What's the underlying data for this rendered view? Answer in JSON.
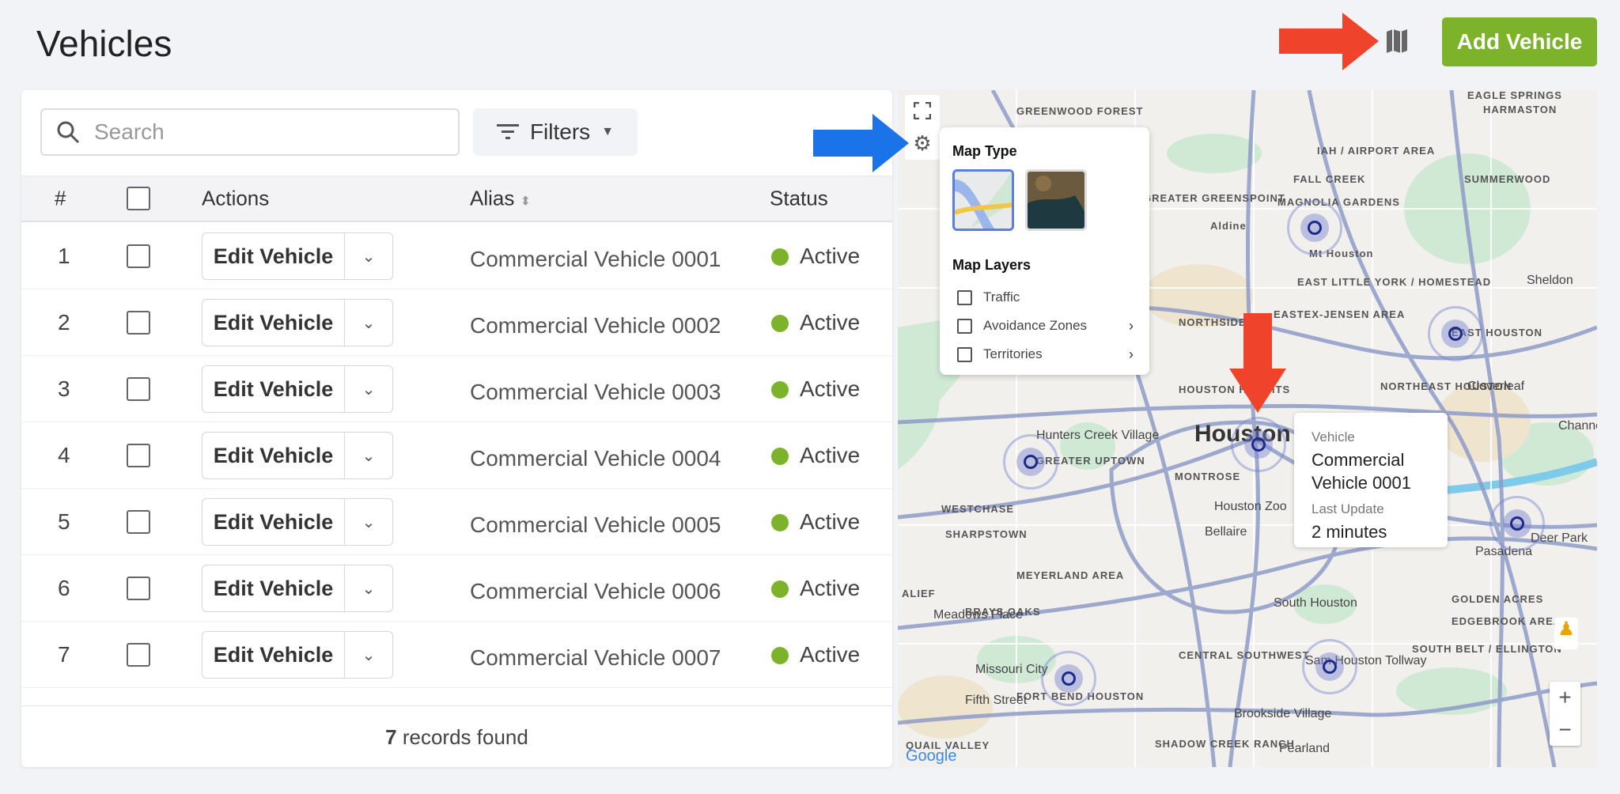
{
  "page": {
    "title": "Vehicles"
  },
  "header": {
    "add_button": "Add Vehicle",
    "map_toggle_icon": "map-icon"
  },
  "toolbar": {
    "search_placeholder": "Search",
    "search_value": "",
    "filters_label": "Filters"
  },
  "table": {
    "columns": [
      "#",
      "",
      "Actions",
      "Alias",
      "Status"
    ],
    "edit_label": "Edit Vehicle",
    "rows": [
      {
        "n": "1",
        "alias": "Commercial Vehicle 0001",
        "status": "Active"
      },
      {
        "n": "2",
        "alias": "Commercial Vehicle 0002",
        "status": "Active"
      },
      {
        "n": "3",
        "alias": "Commercial Vehicle 0003",
        "status": "Active"
      },
      {
        "n": "4",
        "alias": "Commercial Vehicle 0004",
        "status": "Active"
      },
      {
        "n": "5",
        "alias": "Commercial Vehicle 0005",
        "status": "Active"
      },
      {
        "n": "6",
        "alias": "Commercial Vehicle 0006",
        "status": "Active"
      },
      {
        "n": "7",
        "alias": "Commercial Vehicle 0007",
        "status": "Active"
      }
    ],
    "footer_count": "7",
    "footer_text": " records found"
  },
  "map": {
    "popup": {
      "map_type_title": "Map Type",
      "map_layers_title": "Map Layers",
      "layers": [
        "Traffic",
        "Avoidance Zones",
        "Territories"
      ]
    },
    "tooltip": {
      "vehicle_label": "Vehicle",
      "vehicle_value": "Commercial Vehicle 0001",
      "update_label": "Last Update",
      "update_value": "2 minutes"
    },
    "labels": [
      "GREENWOOD FOREST",
      "GREATER GREENSPOINT",
      "IAH / AIRPORT AREA",
      "MAGNOLIA GARDENS",
      "Aldine",
      "Mt Houston",
      "EAST LITTLE YORK / HOMESTEAD",
      "EASTEX-JENSEN AREA",
      "NORTHSIDE",
      "EAST HOUSTON",
      "HOUSTON HEIGHTS",
      "NORTHEAST HOUSTON",
      "Houston",
      "Cloverleaf",
      "Hunters Creek Village",
      "GREATER UPTOWN",
      "MONTROSE",
      "Houston Zoo",
      "WESTCHASE",
      "SHARPSTOWN",
      "Bellaire",
      "Pasadena",
      "Deer Park",
      "MEYERLAND AREA",
      "ALIEF",
      "BRAYS OAKS",
      "Meadows Place",
      "South Houston",
      "Missouri City",
      "Fifth Street",
      "FORT BEND HOUSTON",
      "CENTRAL SOUTHWEST",
      "Brookside Village",
      "Pearland",
      "SOUTH BELT / ELLINGTON",
      "Sam Houston Tollway",
      "FALL CREEK",
      "SUMMERWOOD",
      "EAGLE SPRINGS",
      "HARMASTON",
      "Sheldon",
      "Channelview",
      "GOLDEN ACRES",
      "EDGEBROOK AREA",
      "QUAIL VALLEY",
      "SHADOW CREEK RANCH",
      "Google"
    ],
    "colors": {
      "marker": "#1e2a8a",
      "accent_green": "#7cb32a",
      "annotation_red": "#f0432c",
      "annotation_blue": "#1a73e8"
    }
  }
}
